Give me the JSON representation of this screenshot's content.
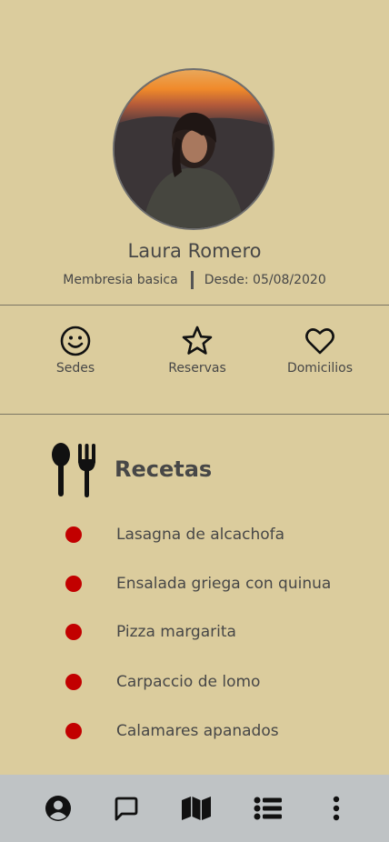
{
  "profile": {
    "name": "Laura Romero",
    "membership": "Membresia basica",
    "since": "Desde: 05/08/2020"
  },
  "quick_actions": [
    {
      "label": "Sedes",
      "icon": "smile-icon"
    },
    {
      "label": "Reservas",
      "icon": "star-icon"
    },
    {
      "label": "Domicilios",
      "icon": "heart-icon"
    }
  ],
  "recipes": {
    "title": "Recetas",
    "icon": "utensils-icon",
    "items": [
      "Lasagna de alcachofa",
      "Ensalada griega con quinua",
      "Pizza margarita",
      "Carpaccio de lomo",
      "Calamares apanados"
    ]
  },
  "bottom_nav": [
    {
      "icon": "user-circle-icon"
    },
    {
      "icon": "chat-icon"
    },
    {
      "icon": "map-icon"
    },
    {
      "icon": "list-icon"
    },
    {
      "icon": "more-vertical-icon"
    }
  ],
  "colors": {
    "background": "#dbcc9d",
    "bullet": "#c20000",
    "bottom_bar": "#bfc3c5",
    "text": "#474747"
  }
}
